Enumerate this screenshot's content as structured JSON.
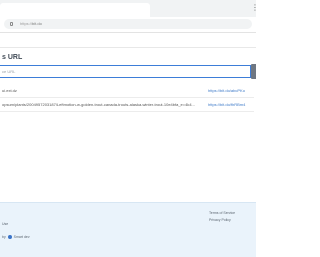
{
  "browser": {
    "tab_title": "",
    "url_scheme": "https://",
    "url_host": "bit.do",
    "menu_icon": "kebab-menu-icon"
  },
  "page": {
    "heading": "s URL",
    "input_placeholder": "ce URL",
    "submit_label": ""
  },
  "links": [
    {
      "long": "ui.ext.dz",
      "short": "https://bit.do/abcPKo"
    },
    {
      "long": "opsum/plants/2004957203187/Leftmotion-w-golden-trout-canada-trouts-alaska-winter-trout-10e4bfa_e=4k4...",
      "short": "https://bit.do/fhRBm4"
    }
  ],
  "footer": {
    "left_text": "Use",
    "right_link_1": "Terms of Service",
    "right_link_2": "Privacy Policy",
    "brand_prefix": "by",
    "brand_suffix": "Smart dev"
  },
  "colors": {
    "accent": "#3d7dd8",
    "link": "#3c79c8",
    "footer_bg": "#eaf3fb"
  }
}
